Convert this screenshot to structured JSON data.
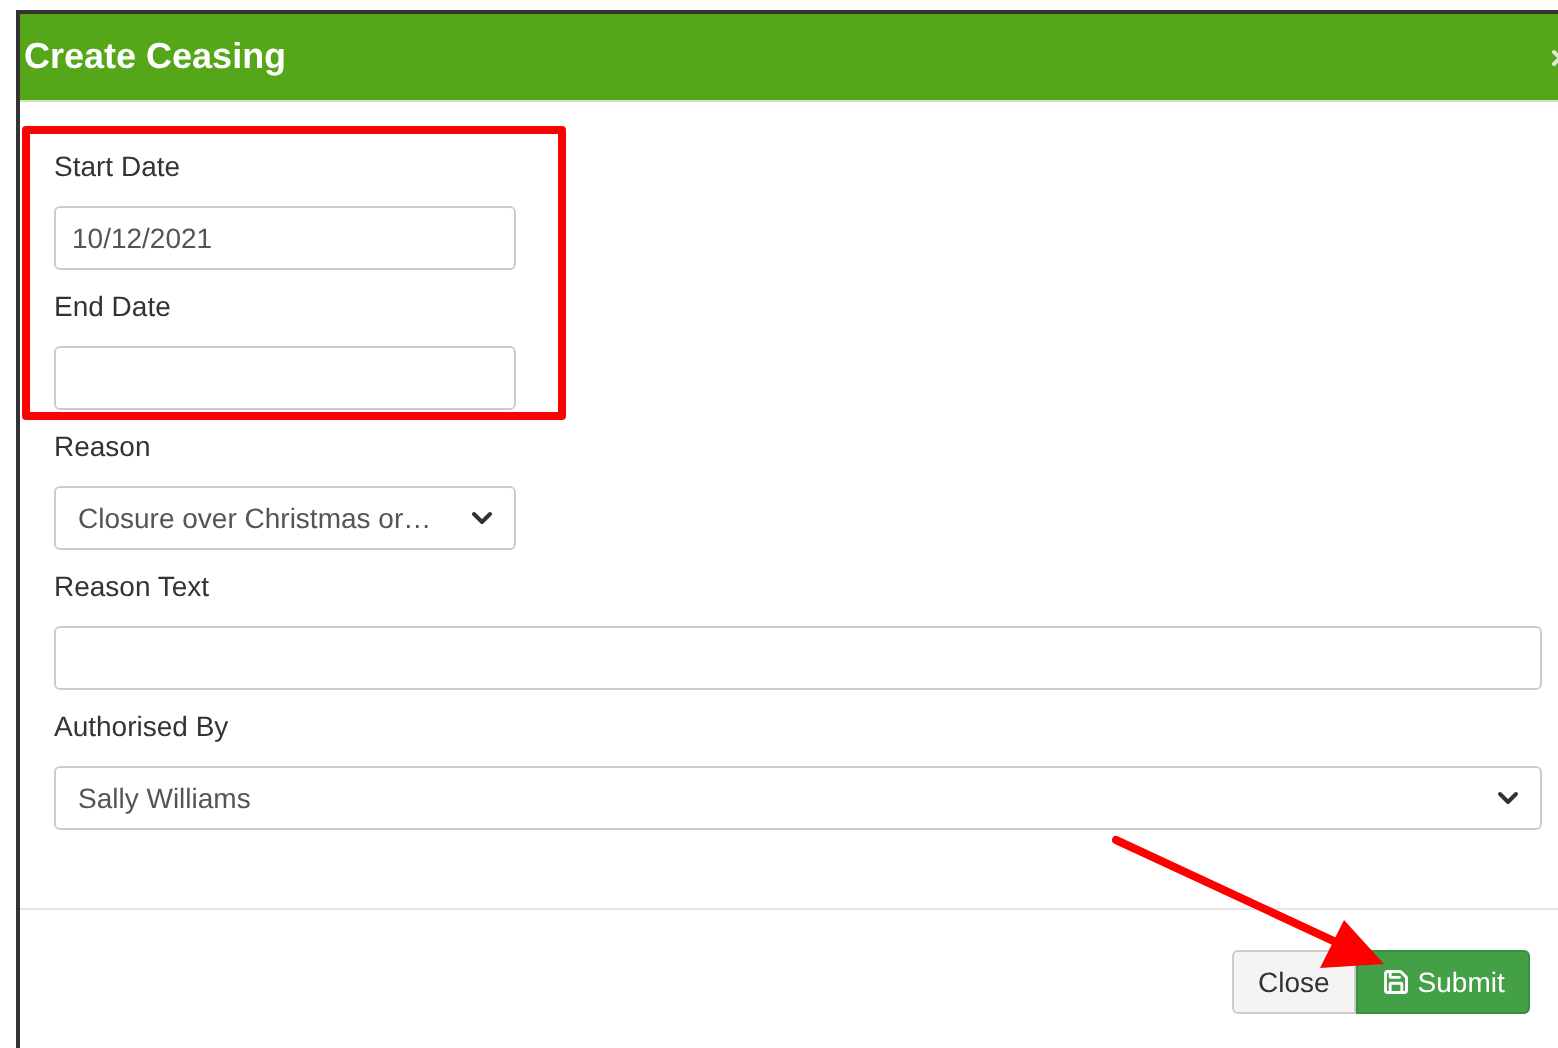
{
  "dialog": {
    "title": "Create Ceasing"
  },
  "fields": [
    {
      "label": "Start Date",
      "kind": "text",
      "value": "10/12/2021"
    },
    {
      "label": "End Date",
      "kind": "text"
    },
    {
      "label": "Reason",
      "kind": "select",
      "value": "Closure over Christmas or…"
    },
    {
      "label": "Reason Text",
      "kind": "text"
    },
    {
      "label": "Authorised By",
      "kind": "select",
      "value": "Sally Williams"
    }
  ],
  "buttons": [
    {
      "label": "Close",
      "kind": "default"
    },
    {
      "label": "Submit",
      "kind": "primary"
    }
  ]
}
